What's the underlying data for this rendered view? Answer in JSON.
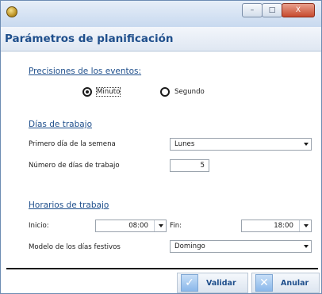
{
  "header": {
    "title": "Parámetros de planificación"
  },
  "window_buttons": {
    "minimize": "–",
    "maximize": "□",
    "close": "X"
  },
  "precision": {
    "heading": "Precisiones de los eventos:",
    "options": [
      {
        "label": "Minuto",
        "selected": true
      },
      {
        "label": "Segundo",
        "selected": false
      }
    ]
  },
  "workdays": {
    "heading": "Días de trabajo",
    "first_day_label": "Primero día de la semena",
    "first_day_value": "Lunes",
    "count_label": "Número de días de trabajo",
    "count_value": "5"
  },
  "hours": {
    "heading": "Horarios de trabajo",
    "start_label": "Inicio:",
    "start_value": "08:00",
    "end_label": "Fin:",
    "end_value": "18:00",
    "holiday_label": "Modelo de los días festivos",
    "holiday_value": "Domingo"
  },
  "buttons": {
    "ok": "Validar",
    "cancel": "Anular"
  },
  "icons": {
    "ok": "check-icon",
    "cancel": "x-icon"
  },
  "colors": {
    "heading": "#1f4f8c",
    "accent": "#8ab8ea"
  }
}
